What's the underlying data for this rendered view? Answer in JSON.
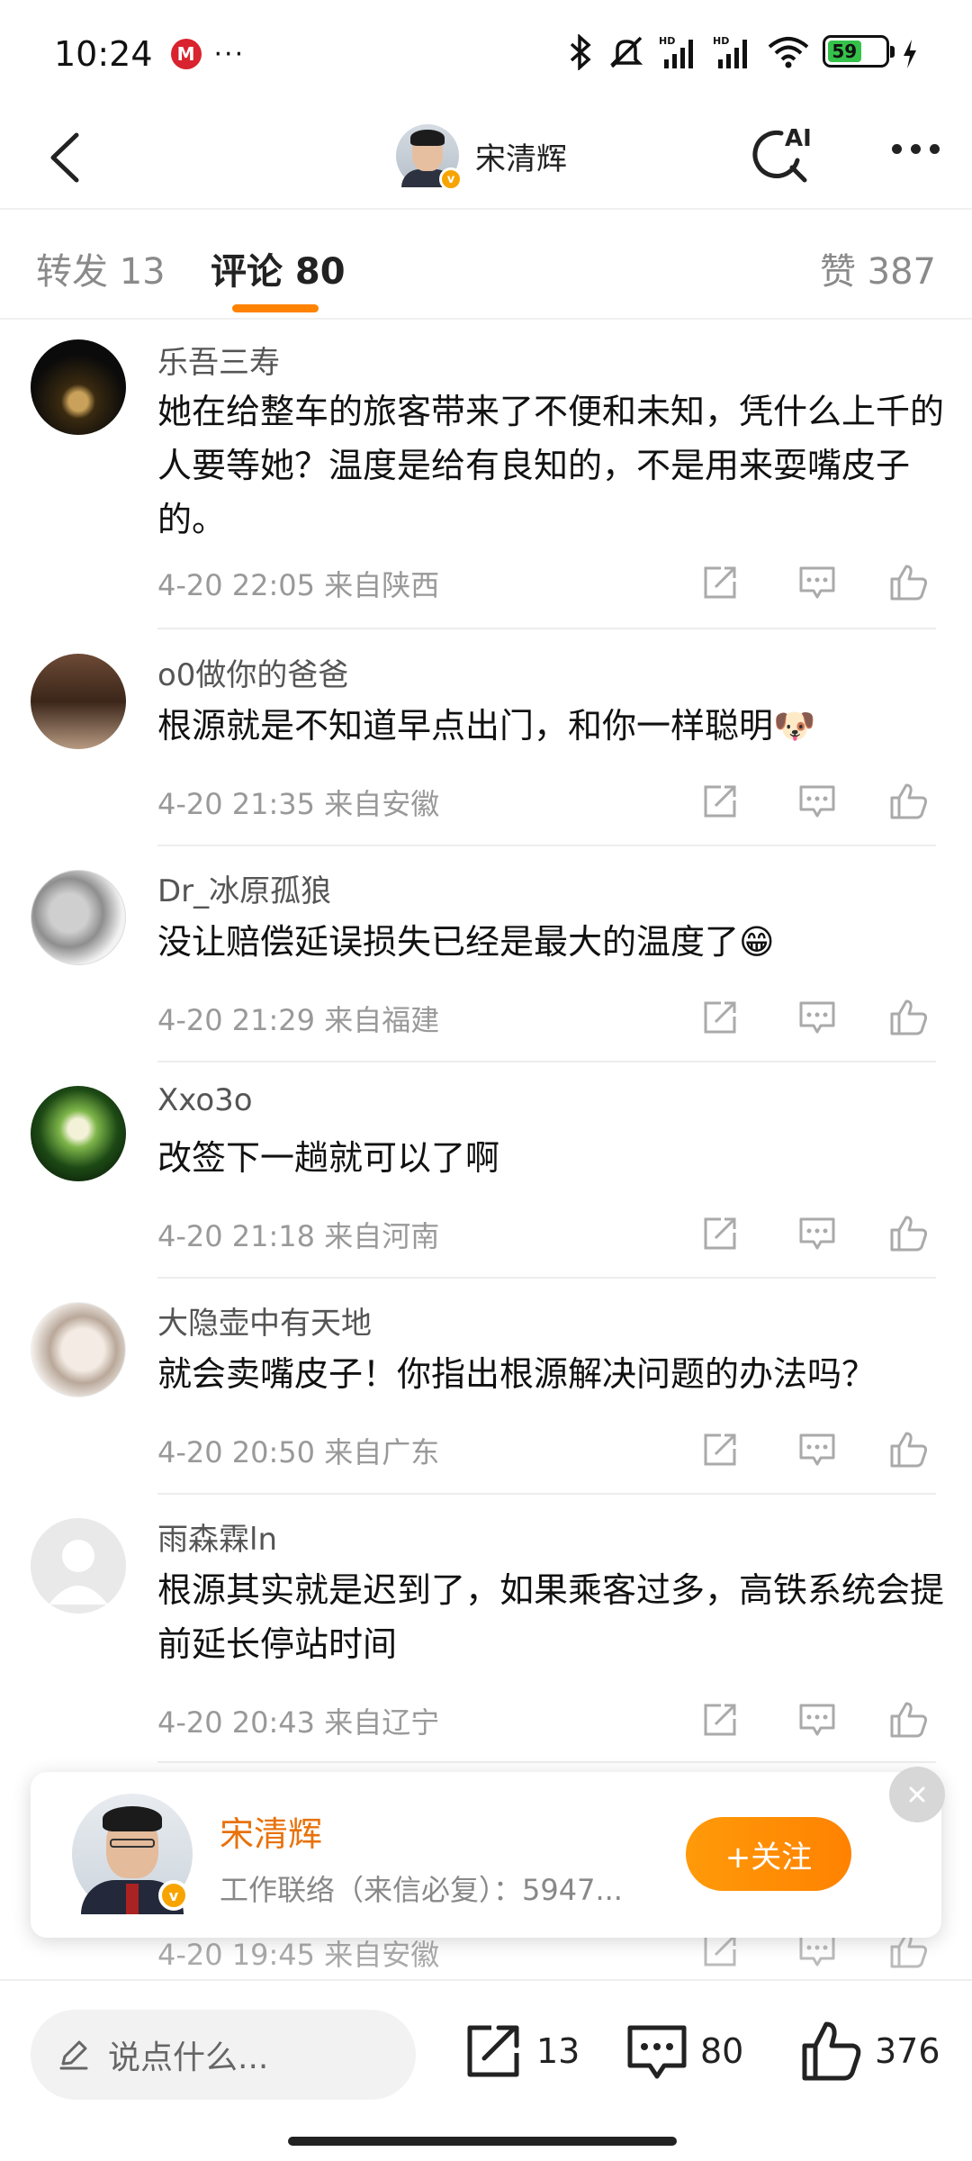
{
  "status_bar": {
    "time": "10:24",
    "dots": "···",
    "battery": "59"
  },
  "nav": {
    "title": "宋清辉",
    "ai_label": "AI"
  },
  "tabs": {
    "repost": "转发 13",
    "comments": "评论 80",
    "likes": "赞 387"
  },
  "comments": [
    {
      "name": "乐吾三寿",
      "text": "她在给整车的旅客带来了不便和未知，凭什么上千的人要等她？温度是给有良知的，不是用来耍嘴皮子的。",
      "meta": "4-20 22:05  来自陕西"
    },
    {
      "name": "o0做你的爸爸",
      "text": "根源就是不知道早点出门，和你一样聪明🐶",
      "meta": "4-20 21:35  来自安徽"
    },
    {
      "name": "Dr_冰原孤狼",
      "text": "没让赔偿延误损失已经是最大的温度了😁",
      "meta": "4-20 21:29  来自福建"
    },
    {
      "name": "Xxo3o",
      "text": "改签下一趟就可以了啊",
      "meta": "4-20 21:18  来自河南"
    },
    {
      "name": "大隐壶中有天地",
      "text": "就会卖嘴皮子！你指出根源解决问题的办法吗？",
      "meta": "4-20 20:50  来自广东"
    },
    {
      "name": "雨森霖ln",
      "text": "根源其实就是迟到了，如果乘客过多，高铁系统会提前延长停站时间",
      "meta": "4-20 20:43  来自辽宁"
    },
    {
      "name": "",
      "text": "",
      "meta": "4-20 19:45  来自安徽"
    }
  ],
  "popup": {
    "name": "宋清辉",
    "description": "工作联络（来信必复）：5947...",
    "follow_label": "+关注"
  },
  "bottom_bar": {
    "input_placeholder": "说点什么...",
    "repost_count": "13",
    "comment_count": "80",
    "like_count": "376"
  },
  "colors": {
    "accent": "#ff8200",
    "verified": "#f7a400",
    "battery": "#35c24a"
  }
}
